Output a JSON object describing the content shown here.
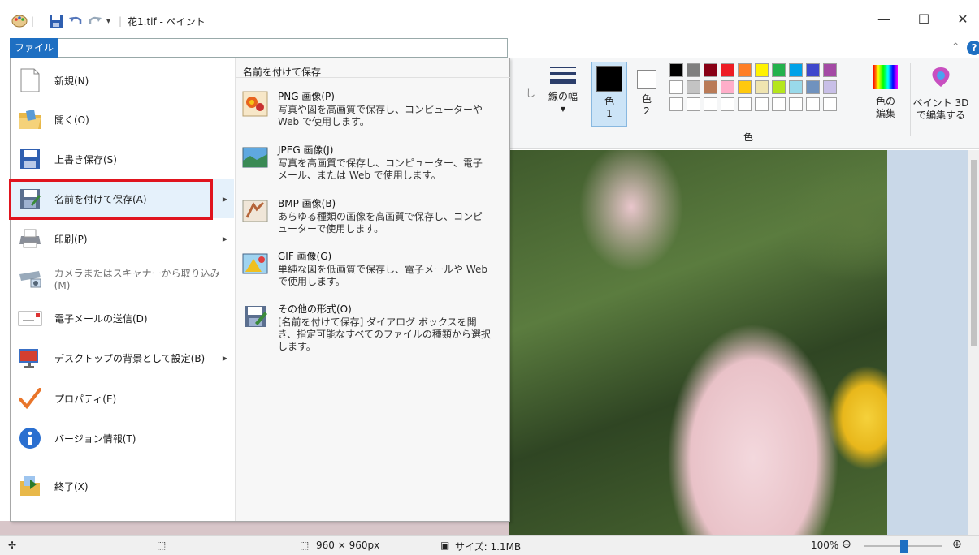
{
  "window": {
    "title": "花1.tif - ペイント",
    "minimize": "—",
    "maximize": "☐",
    "close": "✕"
  },
  "ribbon": {
    "file_tab": "ファイル",
    "hide_label": "し",
    "line_width": "線の幅",
    "color1": [
      "色",
      "1"
    ],
    "color2": [
      "色",
      "2"
    ],
    "edit_colors": [
      "色の",
      "編集"
    ],
    "paint3d": [
      "ペイント 3D",
      "で編集する"
    ],
    "group_color": "色",
    "colors_row1": [
      "#000000",
      "#7f7f7f",
      "#880015",
      "#ed1c24",
      "#ff7f27",
      "#fff200",
      "#22b14c",
      "#00a2e8",
      "#3f48cc",
      "#a349a4"
    ],
    "colors_row2": [
      "#ffffff",
      "#c3c3c3",
      "#b97a57",
      "#ffaec9",
      "#ffc90e",
      "#efe4b0",
      "#b5e61d",
      "#99d9ea",
      "#7092be",
      "#c8bfe7"
    ]
  },
  "file_menu": {
    "items": [
      {
        "label": "新規(N)",
        "icon": "new-file-icon",
        "arrow": false
      },
      {
        "label": "開く(O)",
        "icon": "open-folder-icon",
        "arrow": false
      },
      {
        "label": "上書き保存(S)",
        "icon": "save-disk-icon",
        "arrow": false
      },
      {
        "label": "名前を付けて保存(A)",
        "icon": "save-as-icon",
        "arrow": true
      },
      {
        "label": "印刷(P)",
        "icon": "printer-icon",
        "arrow": true
      },
      {
        "label": "カメラまたはスキャナーから取り込み(M)",
        "icon": "scanner-icon",
        "arrow": false
      },
      {
        "label": "電子メールの送信(D)",
        "icon": "email-icon",
        "arrow": false
      },
      {
        "label": "デスクトップの背景として設定(B)",
        "icon": "desktop-icon",
        "arrow": true
      },
      {
        "label": "プロパティ(E)",
        "icon": "checkmark-icon",
        "arrow": false
      },
      {
        "label": "バージョン情報(T)",
        "icon": "info-icon",
        "arrow": false
      },
      {
        "label": "終了(X)",
        "icon": "exit-icon",
        "arrow": false
      }
    ]
  },
  "save_as_menu": {
    "header": "名前を付けて保存",
    "items": [
      {
        "title": "PNG 画像(P)",
        "desc": "写真や図を高画質で保存し、コンピューターや Web で使用します。",
        "icon": "png-image-icon"
      },
      {
        "title": "JPEG 画像(J)",
        "desc": "写真を高画質で保存し、コンピューター、電子メール、または Web で使用します。",
        "icon": "jpeg-image-icon"
      },
      {
        "title": "BMP 画像(B)",
        "desc": "あらゆる種類の画像を高画質で保存し、コンピューターで使用します。",
        "icon": "bmp-image-icon"
      },
      {
        "title": "GIF 画像(G)",
        "desc": "単純な図を低画質で保存し、電子メールや Web で使用します。",
        "icon": "gif-image-icon"
      },
      {
        "title": "その他の形式(O)",
        "desc": "[名前を付けて保存] ダイアログ ボックスを開き、指定可能なすべてのファイルの種類から選択します。",
        "icon": "other-format-icon"
      }
    ]
  },
  "status": {
    "dimensions": "960 × 960px",
    "size": "サイズ: 1.1MB",
    "zoom": "100%",
    "zoom_slider_value": 0.5
  }
}
